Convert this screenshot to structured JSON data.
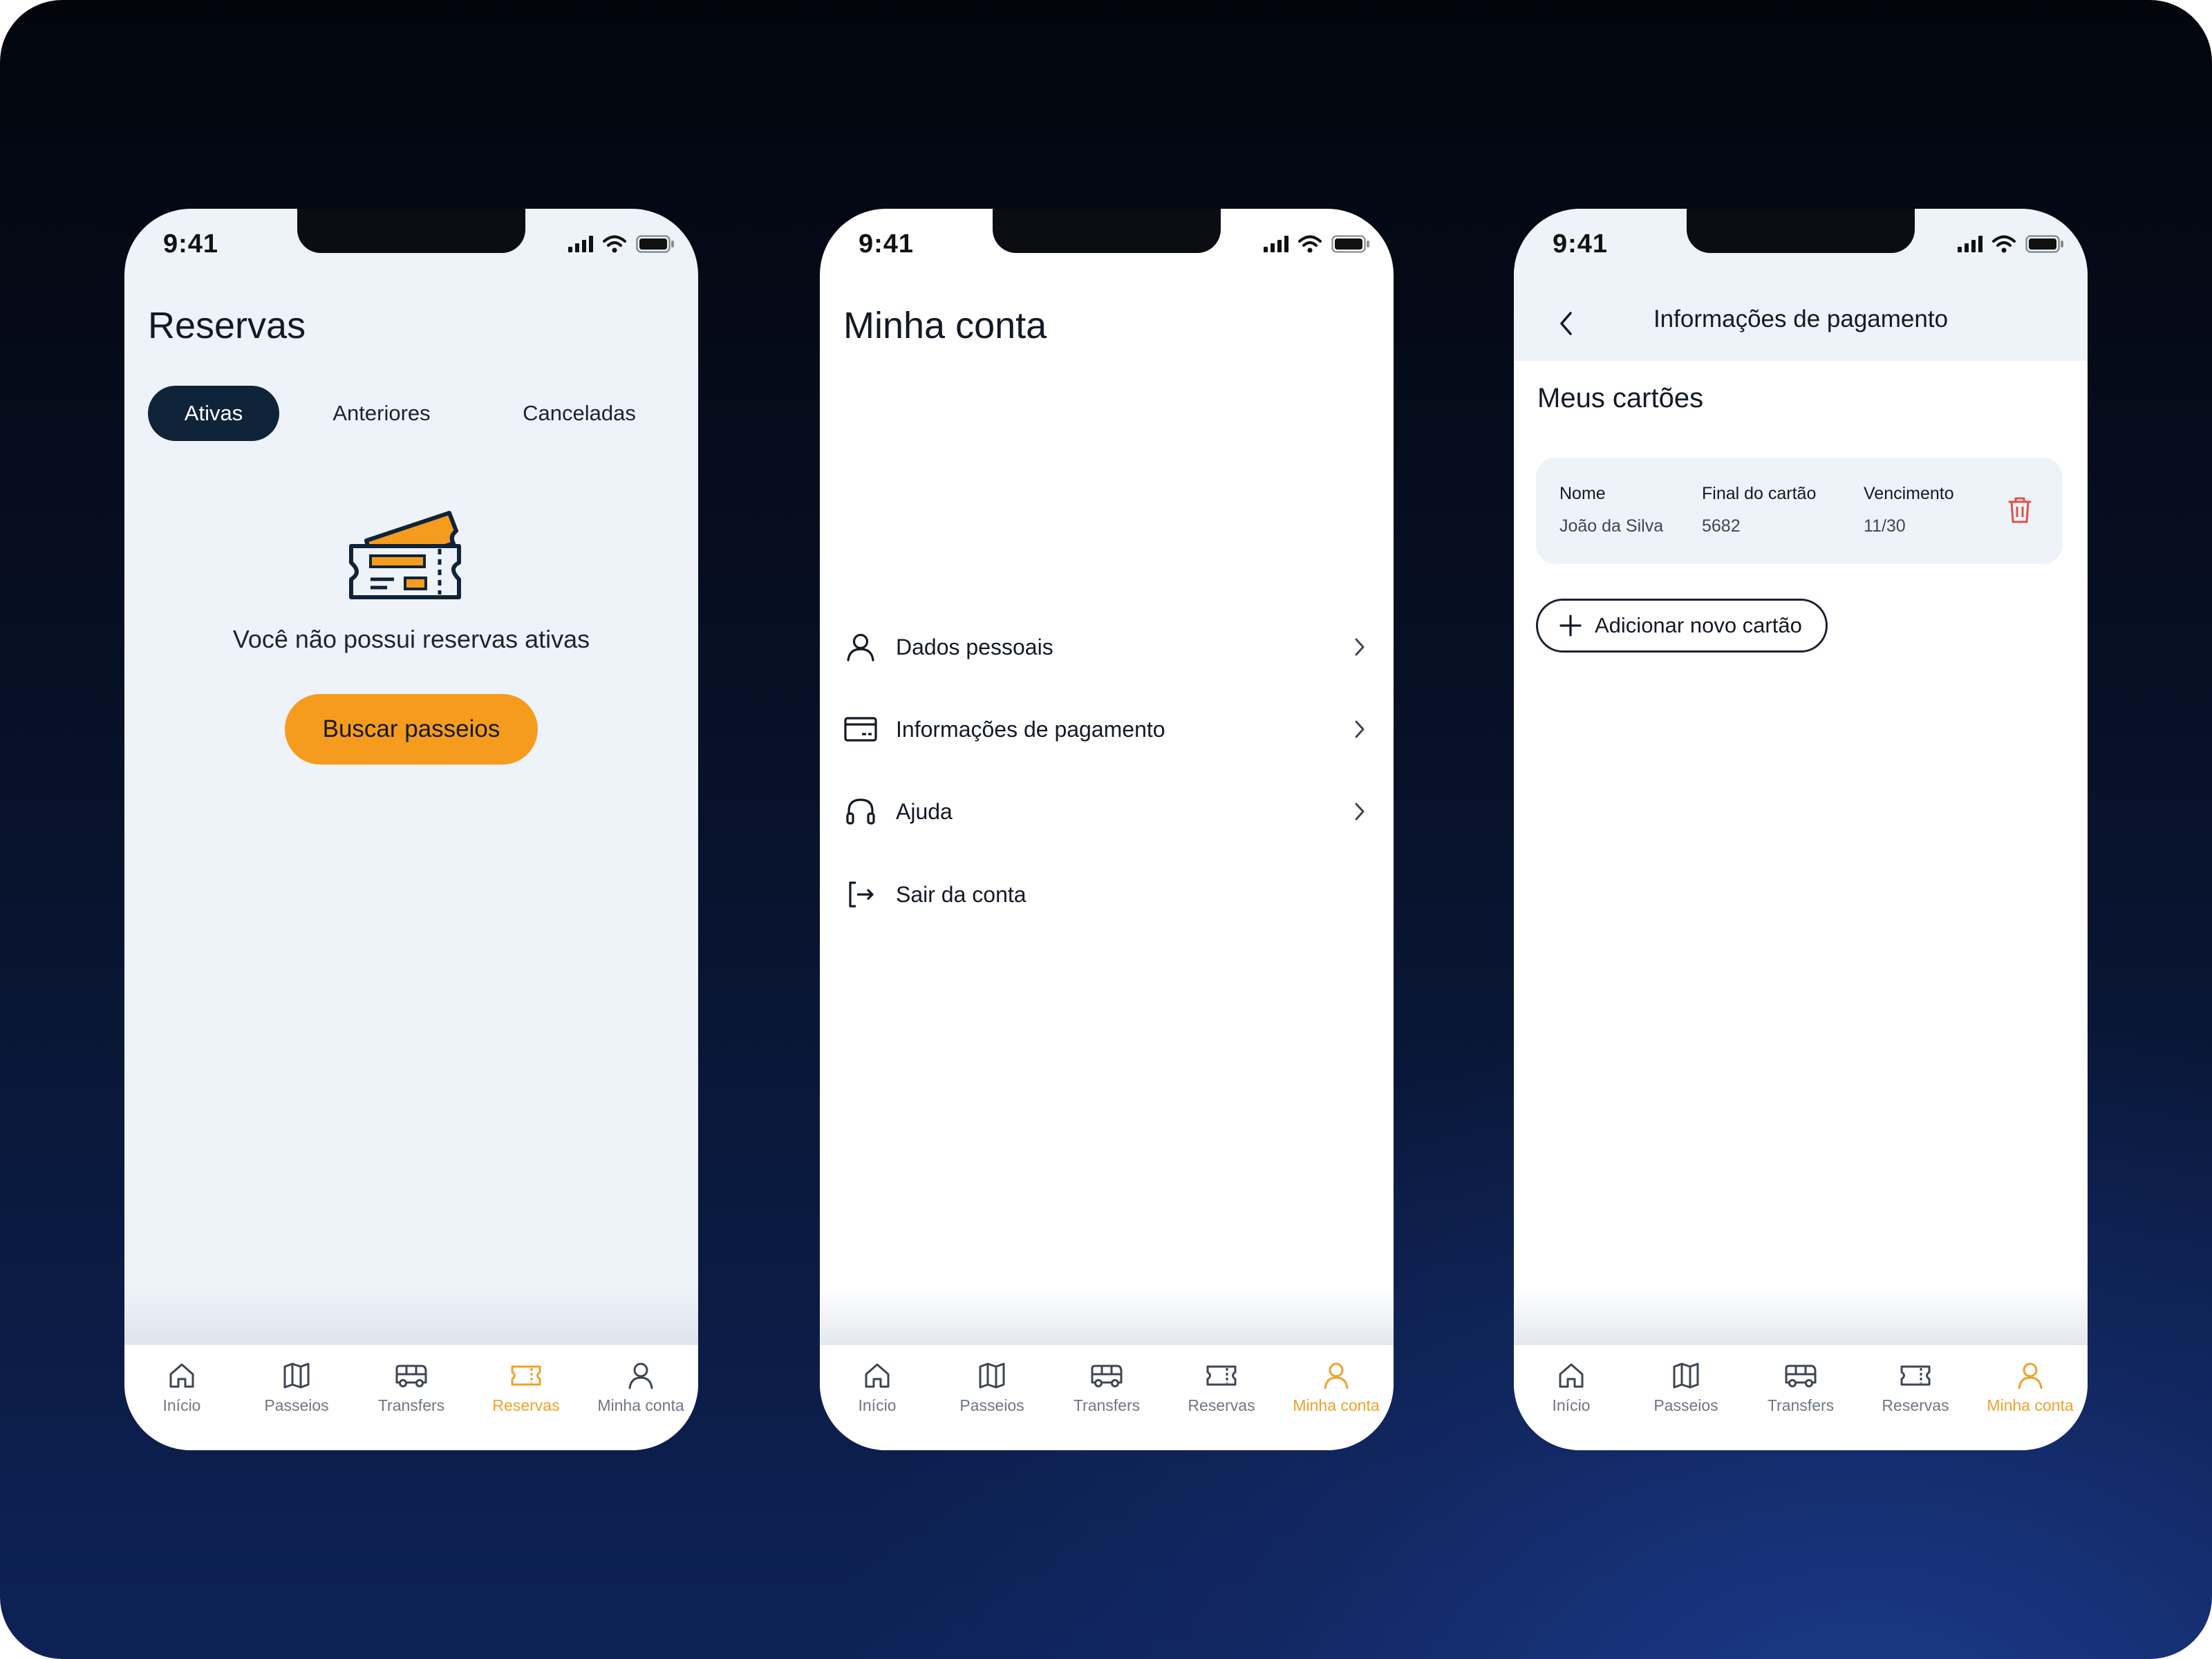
{
  "colors": {
    "accent": "#f59c1f",
    "active_tab": "#f0a12b",
    "dark": "#0f2339",
    "danger": "#e0504b"
  },
  "status_bar": {
    "time": "9:41"
  },
  "tab_bar": {
    "items": [
      {
        "label": "Início",
        "icon": "home-icon"
      },
      {
        "label": "Passeios",
        "icon": "map-icon"
      },
      {
        "label": "Transfers",
        "icon": "bus-icon"
      },
      {
        "label": "Reservas",
        "icon": "ticket-icon"
      },
      {
        "label": "Minha conta",
        "icon": "user-icon"
      }
    ]
  },
  "reservas": {
    "title": "Reservas",
    "segments": [
      "Ativas",
      "Anteriores",
      "Canceladas"
    ],
    "active_segment": "Ativas",
    "empty_message": "Você não possui reservas ativas",
    "cta_label": "Buscar passeios"
  },
  "minha_conta": {
    "title": "Minha conta",
    "menu": [
      {
        "label": "Dados pessoais",
        "icon": "user-icon"
      },
      {
        "label": "Informações de pagamento",
        "icon": "credit-card-icon"
      },
      {
        "label": "Ajuda",
        "icon": "headset-icon"
      },
      {
        "label": "Sair da conta",
        "icon": "logout-icon"
      }
    ]
  },
  "pagamento": {
    "header_title": "Informações de pagamento",
    "section_title": "Meus cartões",
    "card": {
      "name_header": "Nome",
      "name_value": "João da Silva",
      "final_header": "Final do cartão",
      "final_value": "5682",
      "exp_header": "Vencimento",
      "exp_value": "11/30"
    },
    "add_button": "Adicionar novo cartão"
  }
}
